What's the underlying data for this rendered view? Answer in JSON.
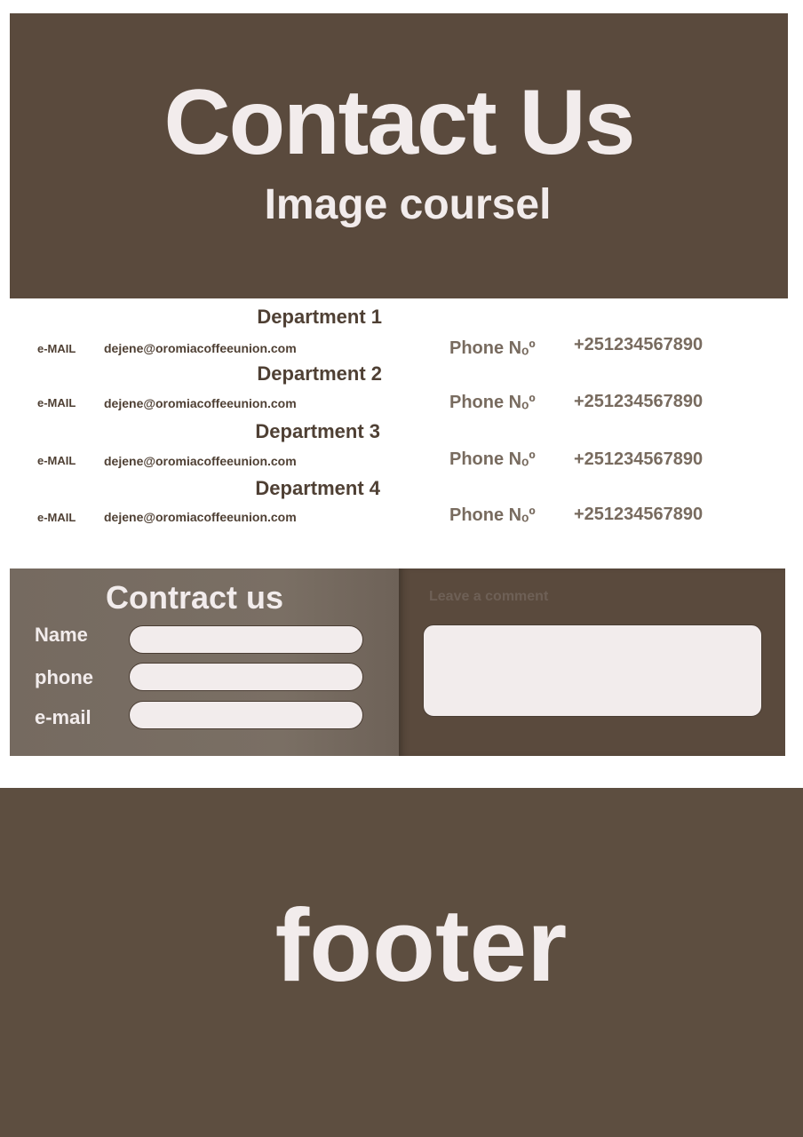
{
  "hero": {
    "title": "Contact Us",
    "subtitle": "Image coursel"
  },
  "departments": [
    {
      "name": "Department 1",
      "email_label": "e-MAIL",
      "email": "dejene@oromiacoffeeunion.com",
      "phone_label": "Phone Nₒº",
      "phone": "+251234567890"
    },
    {
      "name": "Department 2",
      "email_label": "e-MAIL",
      "email": "dejene@oromiacoffeeunion.com",
      "phone_label": "Phone Nₒº",
      "phone": "+251234567890"
    },
    {
      "name": "Department 3",
      "email_label": "e-MAIL",
      "email": "dejene@oromiacoffeeunion.com",
      "phone_label": "Phone Nₒº",
      "phone": "+251234567890"
    },
    {
      "name": "Department 4",
      "email_label": "e-MAIL",
      "email": "dejene@oromiacoffeeunion.com",
      "phone_label": "Phone Nₒº",
      "phone": "+251234567890"
    }
  ],
  "contact_form": {
    "title": "Contract us",
    "name_label": "Name",
    "phone_label": "phone",
    "email_label": "e-mail",
    "name_value": "",
    "phone_value": "",
    "email_value": "",
    "comment_label": "Leave a comment",
    "comment_value": ""
  },
  "footer": {
    "text": "footer"
  },
  "colors": {
    "brand_brown": "#5a4a3d",
    "form_taupe": "#7a6f64",
    "light_text": "#f2ecec",
    "dark_text": "#4f4034",
    "muted_text": "#786b5f"
  }
}
